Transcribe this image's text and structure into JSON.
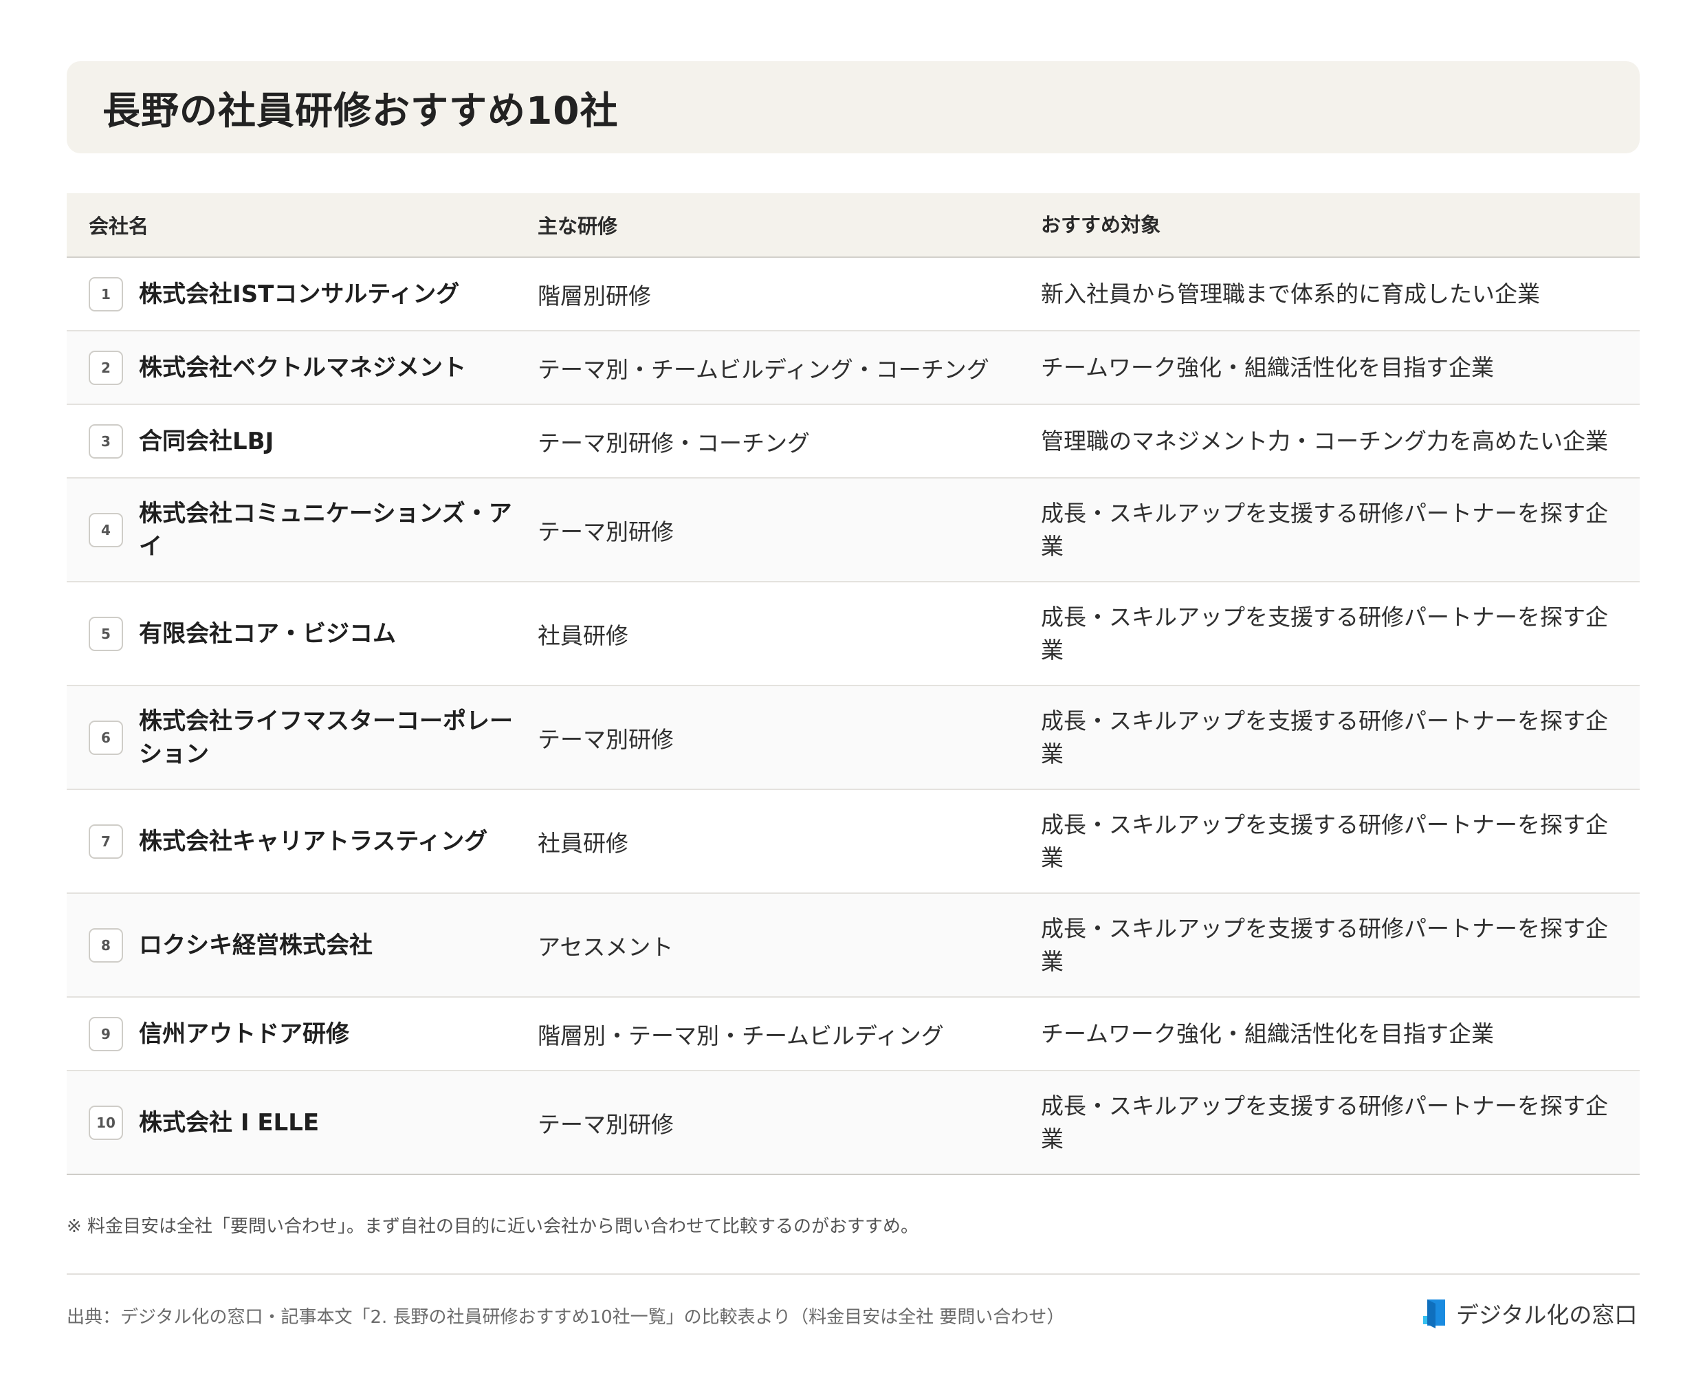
{
  "title": "長野の社員研修おすすめ10社",
  "headers": {
    "company": "会社名",
    "training": "主な研修",
    "target": "おすすめ対象"
  },
  "rows": [
    {
      "num": "1",
      "company": "株式会社ISTコンサルティング",
      "training": "階層別研修",
      "target": "新入社員から管理職まで体系的に育成したい企業"
    },
    {
      "num": "2",
      "company": "株式会社ベクトルマネジメント",
      "training": "テーマ別・チームビルディング・コーチング",
      "target": "チームワーク強化・組織活性化を目指す企業"
    },
    {
      "num": "3",
      "company": "合同会社LBJ",
      "training": "テーマ別研修・コーチング",
      "target": "管理職のマネジメント力・コーチング力を高めたい企業"
    },
    {
      "num": "4",
      "company": "株式会社コミュニケーションズ・アイ",
      "training": "テーマ別研修",
      "target": "成長・スキルアップを支援する研修パートナーを探す企業"
    },
    {
      "num": "5",
      "company": "有限会社コア・ビジコム",
      "training": "社員研修",
      "target": "成長・スキルアップを支援する研修パートナーを探す企業"
    },
    {
      "num": "6",
      "company": "株式会社ライフマスターコーポレーション",
      "training": "テーマ別研修",
      "target": "成長・スキルアップを支援する研修パートナーを探す企業"
    },
    {
      "num": "7",
      "company": "株式会社キャリアトラスティング",
      "training": "社員研修",
      "target": "成長・スキルアップを支援する研修パートナーを探す企業"
    },
    {
      "num": "8",
      "company": "ロクシキ経営株式会社",
      "training": "アセスメント",
      "target": "成長・スキルアップを支援する研修パートナーを探す企業"
    },
    {
      "num": "9",
      "company": "信州アウトドア研修",
      "training": "階層別・テーマ別・チームビルディング",
      "target": "チームワーク強化・組織活性化を目指す企業"
    },
    {
      "num": "10",
      "company": "株式会社 I ELLE",
      "training": "テーマ別研修",
      "target": "成長・スキルアップを支援する研修パートナーを探す企業"
    }
  ],
  "note": "※ 料金目安は全社「要問い合わせ」。まず自社の目的に近い会社から問い合わせて比較するのがおすすめ。",
  "source": "出典：デジタル化の窓口・記事本文「2. 長野の社員研修おすすめ10社一覧」の比較表より（料金目安は全社 要問い合わせ）",
  "brand": {
    "name": "デジタル化の窓口",
    "icon": "window-logo-icon",
    "color": "#1a8be0"
  },
  "colors": {
    "header_bg": "#f4f2ec",
    "alt_row_bg": "#fafafa",
    "border": "#e4e2de"
  }
}
